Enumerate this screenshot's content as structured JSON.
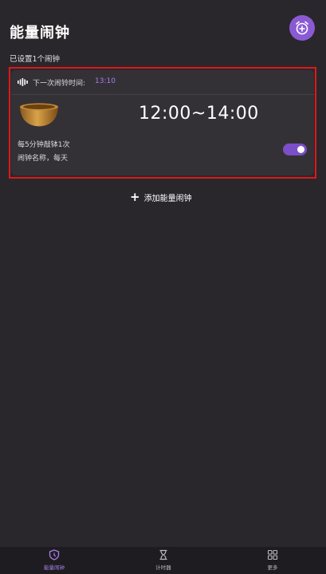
{
  "header": {
    "title": "能量闹钟",
    "subtitle": "已设置1个闹钟",
    "add_icon": "alarm-clock-plus-icon"
  },
  "alarm_card": {
    "next_label": "下一次闹铃时间:",
    "next_time": "13:10",
    "time_range": "12:00~14:00",
    "interval": "每5分钟敲钵1次",
    "name_repeat": "闹钟名称，每天",
    "enabled": true
  },
  "add_button": {
    "label": "添加能量闹钟"
  },
  "bottom_nav": {
    "items": [
      {
        "label": "能量闹钟",
        "icon": "shield-clock-icon",
        "active": true
      },
      {
        "label": "计时器",
        "icon": "hourglass-icon",
        "active": false
      },
      {
        "label": "更多",
        "icon": "grid-icon",
        "active": false
      }
    ]
  },
  "colors": {
    "background": "#2a272c",
    "card": "#343136",
    "accent": "#8a5ad4",
    "highlight_frame": "#e01818"
  }
}
